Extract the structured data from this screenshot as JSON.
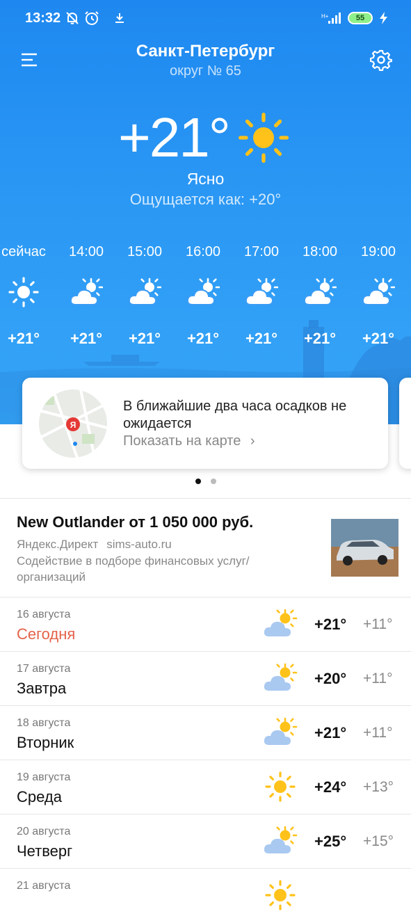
{
  "status_bar": {
    "time": "13:32",
    "battery": "55"
  },
  "header": {
    "city": "Санкт-Петербург",
    "district": "округ № 65"
  },
  "current": {
    "temperature": "+21°",
    "condition": "Ясно",
    "feels_like": "Ощущается как: +20°"
  },
  "hourly": [
    {
      "time": "сейчас",
      "temp": "+21°",
      "icon": "sun-icon"
    },
    {
      "time": "14:00",
      "temp": "+21°",
      "icon": "partly-cloudy-icon"
    },
    {
      "time": "15:00",
      "temp": "+21°",
      "icon": "partly-cloudy-icon"
    },
    {
      "time": "16:00",
      "temp": "+21°",
      "icon": "partly-cloudy-icon"
    },
    {
      "time": "17:00",
      "temp": "+21°",
      "icon": "partly-cloudy-icon"
    },
    {
      "time": "18:00",
      "temp": "+21°",
      "icon": "partly-cloudy-icon"
    },
    {
      "time": "19:00",
      "temp": "+21°",
      "icon": "partly-cloudy-icon"
    }
  ],
  "precip_card": {
    "message": "В ближайшие два часа осадков не ожидается",
    "link": "Показать на карте",
    "map_marker": "Я"
  },
  "ad": {
    "title": "New Outlander от 1 050 000 руб.",
    "source": "Яндекс.Директ",
    "domain": "sims-auto.ru",
    "description": "Содействие в подборе финансовых услуг/организаций"
  },
  "forecast": [
    {
      "date": "16 августа",
      "day": "Сегодня",
      "hi": "+21°",
      "lo": "+11°",
      "icon": "partly-cloudy-icon",
      "today": true
    },
    {
      "date": "17 августа",
      "day": "Завтра",
      "hi": "+20°",
      "lo": "+11°",
      "icon": "partly-cloudy-icon"
    },
    {
      "date": "18 августа",
      "day": "Вторник",
      "hi": "+21°",
      "lo": "+11°",
      "icon": "partly-cloudy-icon"
    },
    {
      "date": "19 августа",
      "day": "Среда",
      "hi": "+24°",
      "lo": "+13°",
      "icon": "sun-icon"
    },
    {
      "date": "20 августа",
      "day": "Четверг",
      "hi": "+25°",
      "lo": "+15°",
      "icon": "partly-cloudy-icon"
    },
    {
      "date": "21 августа",
      "day": "",
      "hi": "",
      "lo": "",
      "icon": "sun-icon"
    }
  ],
  "colors": {
    "sky": "#2a97f4",
    "sun": "#ffc21a",
    "today": "#e4624a"
  }
}
